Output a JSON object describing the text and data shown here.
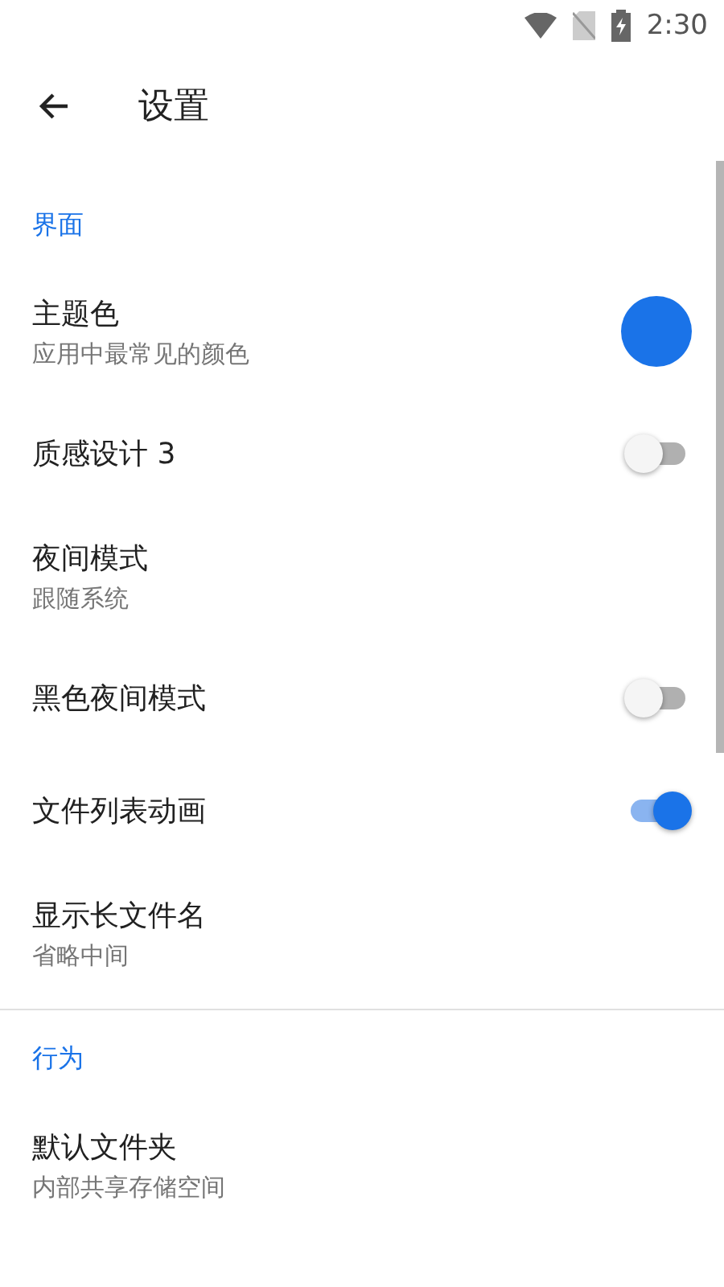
{
  "status_bar": {
    "time": "2:30"
  },
  "app_bar": {
    "title": "设置"
  },
  "sections": [
    {
      "header": "界面",
      "items": [
        {
          "kind": "color",
          "title": "主题色",
          "subtitle": "应用中最常见的颜色",
          "color": "#1a73e8"
        },
        {
          "kind": "switch",
          "title": "质感设计 3",
          "on": false
        },
        {
          "kind": "text",
          "title": "夜间模式",
          "subtitle": "跟随系统"
        },
        {
          "kind": "switch",
          "title": "黑色夜间模式",
          "on": false
        },
        {
          "kind": "switch",
          "title": "文件列表动画",
          "on": true
        },
        {
          "kind": "text",
          "title": "显示长文件名",
          "subtitle": "省略中间"
        }
      ]
    },
    {
      "header": "行为",
      "items": [
        {
          "kind": "text",
          "title": "默认文件夹",
          "subtitle": "内部共享存储空间"
        }
      ]
    }
  ]
}
